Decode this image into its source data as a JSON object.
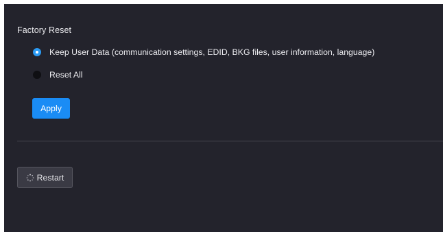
{
  "factory_reset": {
    "title": "Factory Reset",
    "options": [
      {
        "label": "Keep User Data (communication settings, EDID, BKG files, user information, language)",
        "selected": true
      },
      {
        "label": "Reset All",
        "selected": false
      }
    ],
    "apply_label": "Apply"
  },
  "restart": {
    "label": "Restart",
    "icon": "loading-spinner-icon"
  },
  "colors": {
    "background": "#23232c",
    "accent": "#1a8cf5",
    "radio_selected": "#2b9bf4",
    "secondary_button": "#3a3a44"
  }
}
